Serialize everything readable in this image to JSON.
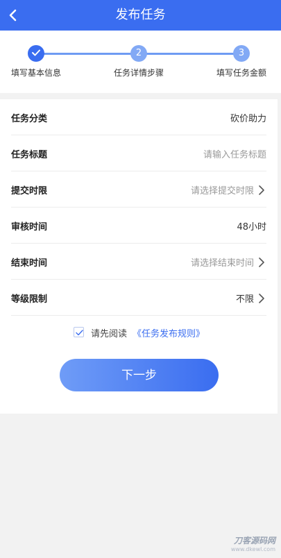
{
  "header": {
    "title": "发布任务"
  },
  "steps": [
    {
      "label": "填写基本信息",
      "number": "",
      "done": true
    },
    {
      "label": "任务详情步骤",
      "number": "2",
      "done": false
    },
    {
      "label": "填写任务金额",
      "number": "3",
      "done": false
    }
  ],
  "form": {
    "category": {
      "label": "任务分类",
      "value": "砍价助力"
    },
    "title": {
      "label": "任务标题",
      "placeholder": "请输入任务标题"
    },
    "submit_limit": {
      "label": "提交时限",
      "placeholder": "请选择提交时限"
    },
    "review_time": {
      "label": "审核时间",
      "value": "48小时"
    },
    "end_time": {
      "label": "结束时间",
      "placeholder": "请选择结束时间"
    },
    "level_limit": {
      "label": "等级限制",
      "value": "不限"
    }
  },
  "agreement": {
    "text": "请先阅读",
    "link": "《任务发布规则》",
    "checked": true
  },
  "next_button": "下一步",
  "watermark": {
    "brand": "刀客源码网",
    "url": "www.dkewl.com"
  },
  "colors": {
    "primary": "#3a6df0",
    "step_light": "#82a9f5",
    "background": "#f2f2f2"
  }
}
